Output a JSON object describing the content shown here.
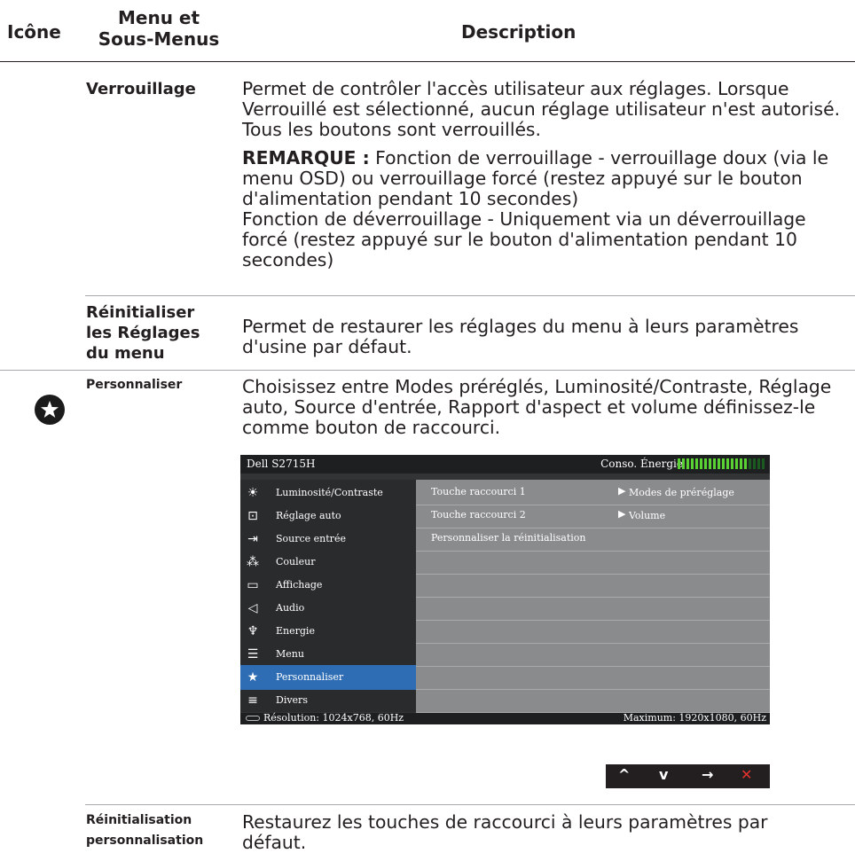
{
  "headers": {
    "icon": "Icône",
    "menu_line1": "Menu et",
    "menu_line2": "Sous-Menus",
    "description": "Description"
  },
  "rows": {
    "lock": {
      "label": "Verrouillage",
      "desc1": "Permet de contrôler l'accès utilisateur aux réglages. Lorsque Verrouillé est sélectionné, aucun réglage utilisateur n'est autorisé. Tous les boutons sont verrouillés.",
      "note_label": "REMARQUE :",
      "note_text": " Fonction de verrouillage - verrouillage doux (via le menu OSD) ou verrouillage forcé (restez appuyé sur le bouton d'alimentation pendant 10 secondes)",
      "note_text2": "Fonction de déverrouillage - Uniquement via un déverrouillage forcé (restez appuyé sur le bouton d'alimentation pendant 10 secondes)"
    },
    "reset": {
      "label_line1": "Réinitialiser",
      "label_line2": "les Réglages",
      "label_line3": "du menu",
      "desc": "Permet de restaurer les réglages du menu à leurs paramètres d'usine par défaut."
    },
    "personalize": {
      "label": "Personnaliser",
      "desc": "Choisissez entre Modes préréglés, Luminosité/Contraste, Réglage auto, Source d'entrée, Rapport d'aspect et volume définissez-le comme bouton de raccourci."
    },
    "custom_reset": {
      "label_line1": "Réinitialisation",
      "label_line2": "personnalisation",
      "desc": "Restaurez les touches de raccourci à leurs paramètres par défaut."
    }
  },
  "osd": {
    "title": "Dell S2715H",
    "energy_label": "Conso. Énergie",
    "energy_level": 0.8,
    "menu_items": [
      {
        "label": "Luminosité/Contraste",
        "icon": "brightness-icon"
      },
      {
        "label": "Réglage auto",
        "icon": "auto-adjust-icon"
      },
      {
        "label": "Source entrée",
        "icon": "input-source-icon"
      },
      {
        "label": "Couleur",
        "icon": "color-icon"
      },
      {
        "label": "Affichage",
        "icon": "display-icon"
      },
      {
        "label": "Audio",
        "icon": "speaker-icon"
      },
      {
        "label": "Energie",
        "icon": "energy-icon"
      },
      {
        "label": "Menu",
        "icon": "menu-icon"
      },
      {
        "label": "Personnaliser",
        "icon": "star-icon"
      },
      {
        "label": "Divers",
        "icon": "sliders-icon"
      }
    ],
    "selected_item": "Personnaliser",
    "options": [
      {
        "key": "Touche raccourci 1",
        "value": "Modes de préréglage"
      },
      {
        "key": "Touche raccourci 2",
        "value": "Volume"
      },
      {
        "key": "Personnaliser la réinitialisation",
        "value": ""
      }
    ],
    "resolution": "Résolution: 1024x768, 60Hz",
    "maximum": "Maximum: 1920x1080, 60Hz"
  },
  "buttons": [
    {
      "symbol": "^",
      "name": "up-button"
    },
    {
      "symbol": "v",
      "name": "down-button"
    },
    {
      "symbol": "→",
      "name": "enter-button"
    },
    {
      "symbol": "✕",
      "name": "exit-button"
    }
  ],
  "colors": {
    "text": "#231f20",
    "osd_selected": "#2e6db4",
    "energy_bar": "#5bd233",
    "exit_red": "#e5322d"
  }
}
